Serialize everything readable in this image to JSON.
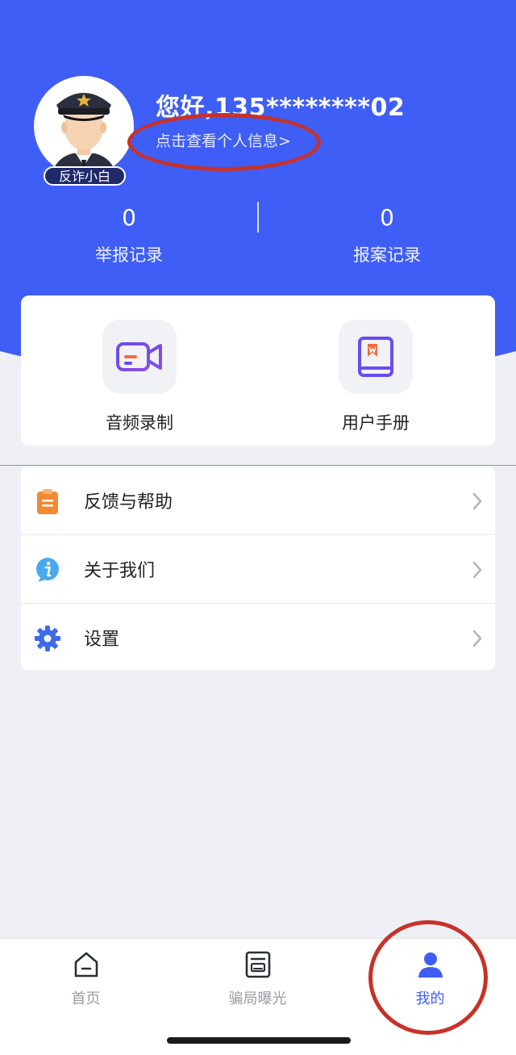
{
  "header": {
    "greeting": "您好,135********02",
    "view_info": "点击查看个人信息>",
    "badge": "反诈小白"
  },
  "stats": [
    {
      "value": "0",
      "label": "举报记录"
    },
    {
      "value": "0",
      "label": "报案记录"
    }
  ],
  "features": [
    {
      "label": "音频录制",
      "icon": "video-camera-icon"
    },
    {
      "label": "用户手册",
      "icon": "book-icon"
    }
  ],
  "menu": [
    {
      "label": "反馈与帮助",
      "icon": "clipboard-icon"
    },
    {
      "label": "关于我们",
      "icon": "info-icon"
    },
    {
      "label": "设置",
      "icon": "gear-icon"
    }
  ],
  "bottom_nav": [
    {
      "label": "首页",
      "icon": "home-icon"
    },
    {
      "label": "骗局曝光",
      "icon": "news-icon"
    },
    {
      "label": "我的",
      "icon": "user-icon",
      "active": true
    }
  ],
  "colors": {
    "primary": "#3f5ef5",
    "annotation_ring": "#c8312a",
    "background": "#eef0f5"
  }
}
